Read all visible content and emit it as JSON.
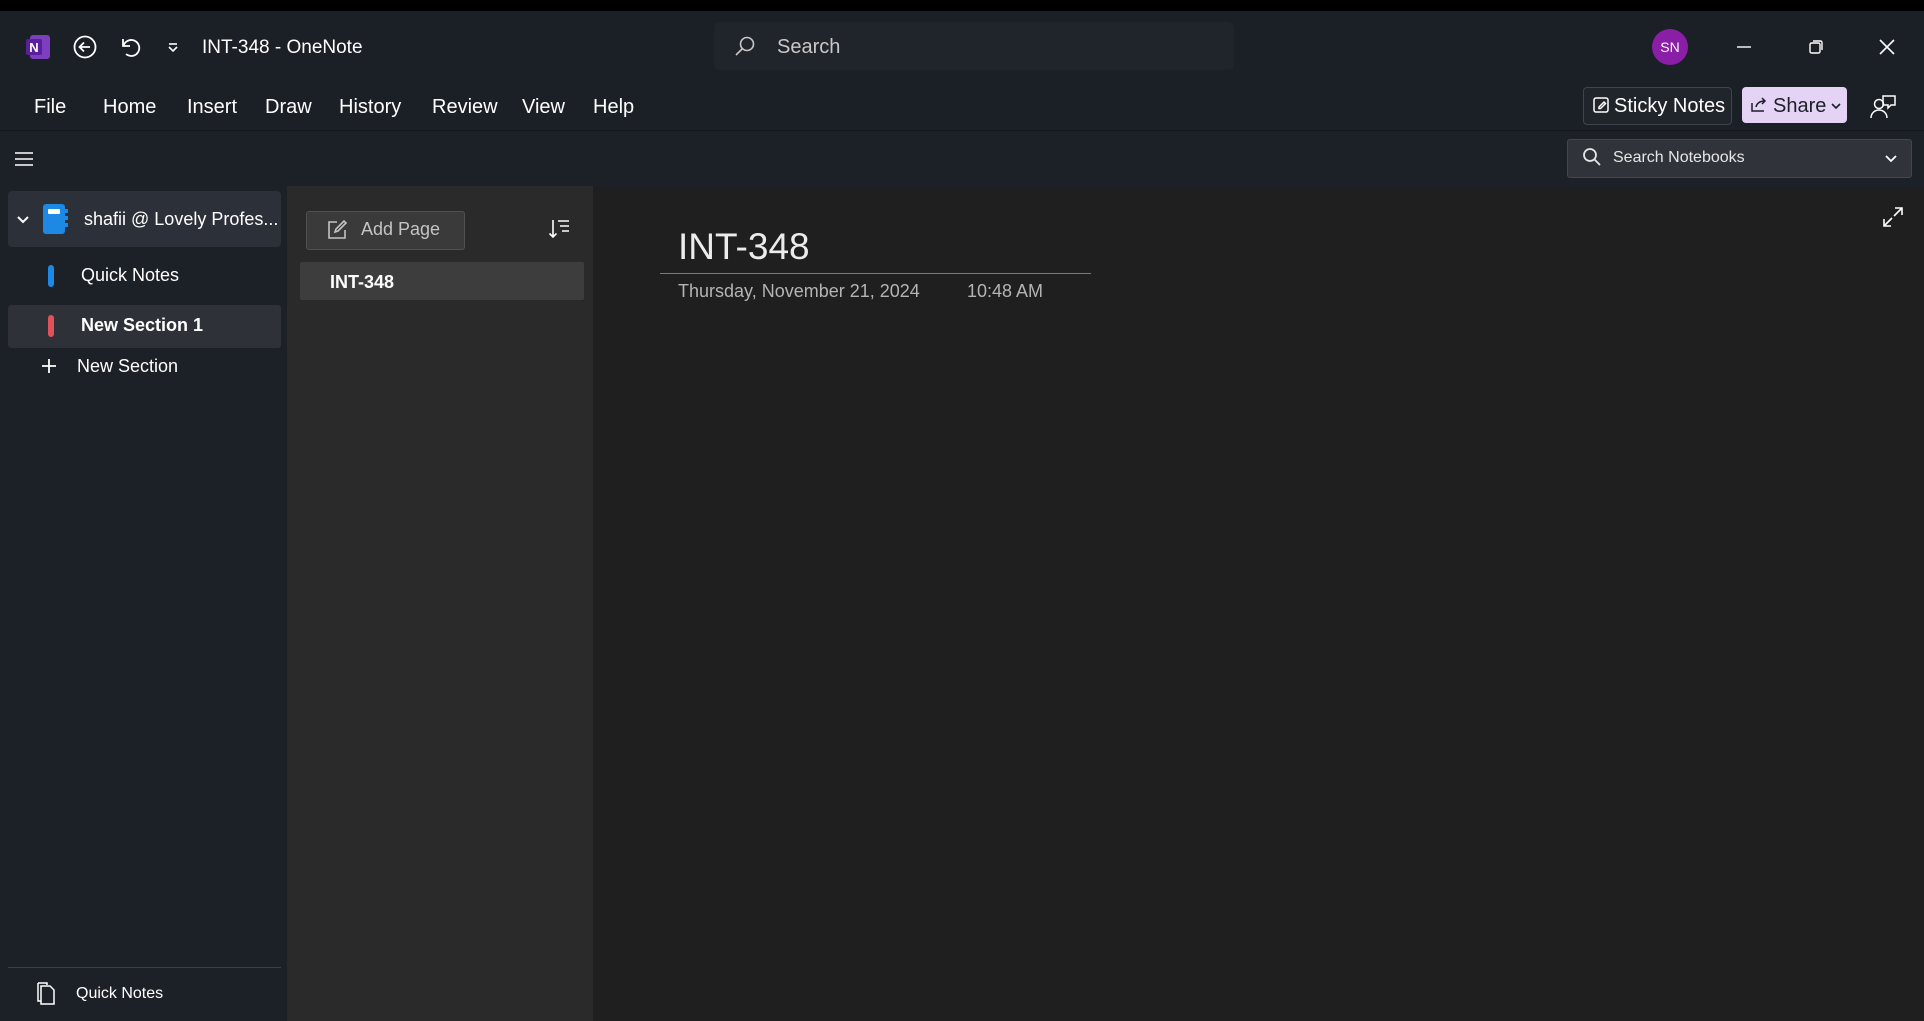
{
  "window": {
    "title": "INT-348  -  OneNote",
    "search_placeholder": "Search",
    "avatar_initials": "SN"
  },
  "menu": [
    "File",
    "Home",
    "Insert",
    "Draw",
    "History",
    "Review",
    "View",
    "Help"
  ],
  "ribbon_buttons": {
    "sticky_notes": "Sticky Notes",
    "share": "Share"
  },
  "notebook_search": {
    "placeholder": "Search Notebooks"
  },
  "sidebar": {
    "notebook_name": "shafii @ Lovely Profes...",
    "sections": [
      {
        "label": "Quick Notes",
        "color": "#1e88e5",
        "selected": false
      },
      {
        "label": "New Section 1",
        "color": "#e0525a",
        "selected": true
      }
    ],
    "new_section_label": "New Section",
    "bottom_label": "Quick Notes"
  },
  "pages": {
    "add_page_label": "Add Page",
    "items": [
      "INT-348"
    ]
  },
  "page": {
    "title": "INT-348",
    "date": "Thursday, November 21, 2024",
    "time": "10:48 AM"
  },
  "colors": {
    "accent_purple": "#7b3fbf",
    "avatar": "#8a1ea6",
    "share_bg": "#e4d3f5",
    "notebook_blue": "#1e88e5"
  }
}
